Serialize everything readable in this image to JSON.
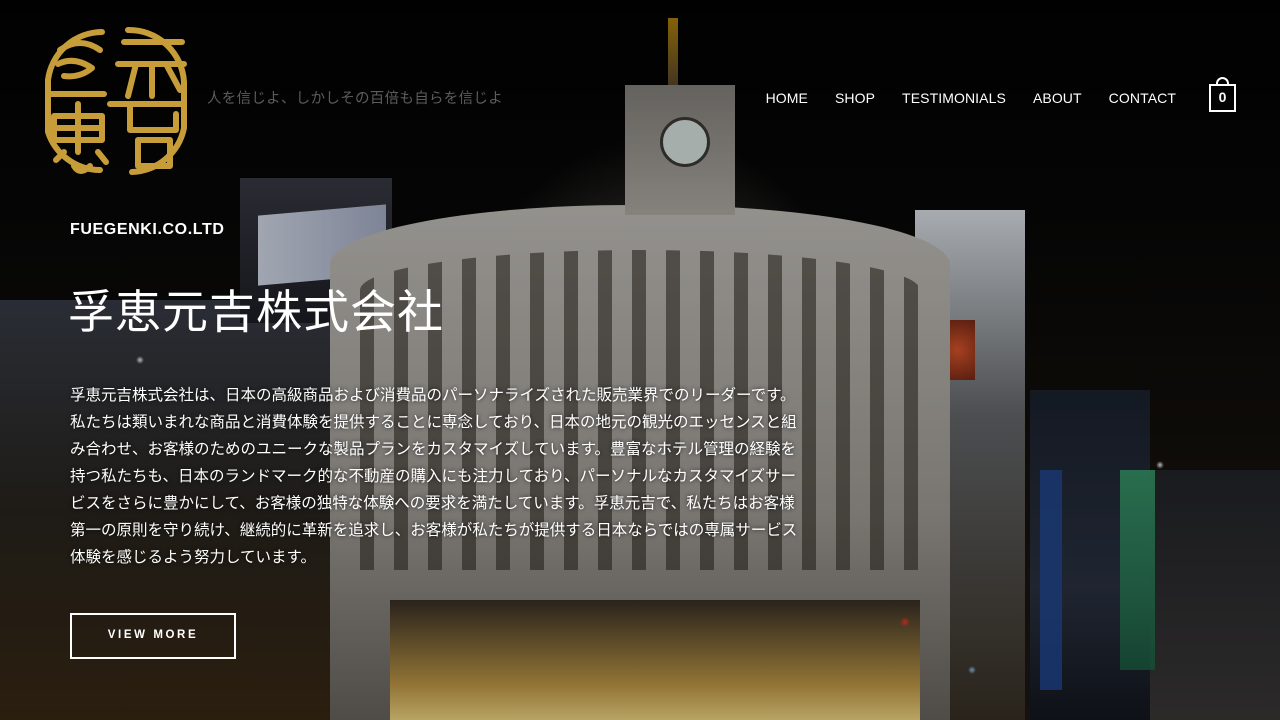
{
  "brand": {
    "logo_text": "浮恵元吉",
    "logo_color": "#c79d3a",
    "tagline": "人を信じよ、しかしその百倍も自らを信じよ"
  },
  "nav": {
    "items": [
      {
        "label": "HOME"
      },
      {
        "label": "SHOP"
      },
      {
        "label": "TESTIMONIALS"
      },
      {
        "label": "ABOUT"
      },
      {
        "label": "CONTACT"
      }
    ]
  },
  "cart": {
    "icon": "shopping-bag-icon",
    "count": "0"
  },
  "hero": {
    "eyebrow": "FUEGENKI.CO.LTD",
    "title": "孚恵元吉株式会社",
    "body": "孚恵元吉株式会社は、日本の高級商品および消費品のパーソナライズされた販売業界でのリーダーです。私たちは類いまれな商品と消費体験を提供することに専念しており、日本の地元の観光のエッセンスと組み合わせ、お客様のためのユニークな製品プランをカスタマイズしています。豊富なホテル管理の経験を持つ私たちも、日本のランドマーク的な不動産の購入にも注力しており、パーソナルなカスタマイズサービスをさらに豊かにして、お客様の独特な体験への要求を満たしています。孚恵元吉で、私たちはお客様第一の原則を守り続け、継続的に革新を追求し、お客様が私たちが提供する日本ならではの専属サービス体験を感じるよう努力しています。",
    "cta_label": "VIEW MORE"
  }
}
